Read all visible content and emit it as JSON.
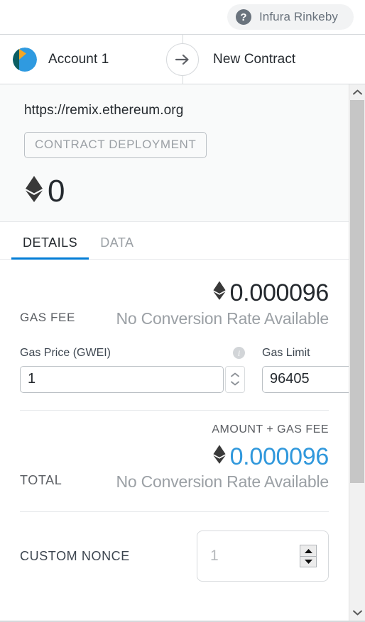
{
  "network": {
    "icon": "question-mark-icon",
    "label": "Infura Rinkeby"
  },
  "parties": {
    "from_name": "Account 1",
    "to_name": "New Contract",
    "arrow_icon": "arrow-right-icon"
  },
  "origin": {
    "url": "https://remix.ethereum.org",
    "badge": "CONTRACT DEPLOYMENT",
    "amount": "0",
    "currency_icon": "ethereum-icon"
  },
  "tabs": [
    {
      "label": "DETAILS",
      "active": true
    },
    {
      "label": "DATA",
      "active": false
    }
  ],
  "details": {
    "gas_fee_label": "GAS FEE",
    "gas_fee_value": "0.000096",
    "gas_fee_conversion": "No Conversion Rate Available",
    "gas_price_label": "Gas Price (GWEI)",
    "gas_price_value": "1",
    "gas_limit_label": "Gas Limit",
    "gas_limit_value": "96405",
    "amount_plus_gas_label": "AMOUNT + GAS FEE",
    "total_label": "TOTAL",
    "total_value": "0.000096",
    "total_conversion": "No Conversion Rate Available",
    "custom_nonce_label": "CUSTOM NONCE",
    "custom_nonce_placeholder": "1",
    "info_icon": "info-icon"
  },
  "colors": {
    "accent_blue": "#037dd6",
    "total_blue": "#3098dc",
    "muted": "#9ba0a5",
    "border": "#d6d9dc"
  },
  "scrollbar": {
    "up_icon": "chevron-up-icon",
    "down_icon": "chevron-down-icon"
  }
}
